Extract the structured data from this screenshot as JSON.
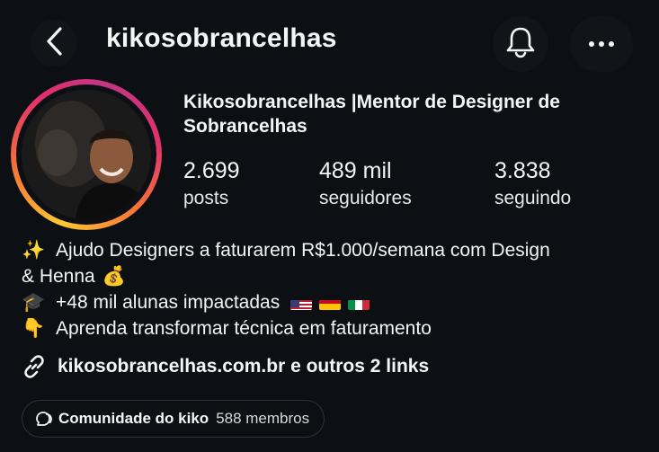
{
  "header": {
    "username": "kikosobrancelhas",
    "icons": [
      "chevron-left-icon",
      "bell-icon",
      "more-horizontal-icon"
    ]
  },
  "profile": {
    "display_name": "Kikosobrancelhas |Mentor de Designer de Sobrancelhas",
    "stats": [
      {
        "value": "2.699",
        "label": "posts"
      },
      {
        "value": "489 mil",
        "label": "seguidores"
      },
      {
        "value": "3.838",
        "label": "seguindo"
      }
    ]
  },
  "bio": {
    "line1_emoji": "✨",
    "line1_text": "Ajudo Designers a faturarem R$1.000/semana com Design",
    "line1b_text": "& Henna",
    "line1b_emoji": "💰",
    "line2_emoji": "🎓",
    "line2_text": "+48 mil alunas impactadas",
    "line3_emoji": "👇",
    "line3_text": "Aprenda transformar técnica em faturamento"
  },
  "links": {
    "text": "kikosobrancelhas.com.br e outros 2 links"
  },
  "community": {
    "name": "Comunidade do kiko",
    "members": "588 membros"
  },
  "colors": {
    "background": "#0c1014",
    "text": "#f5f5f5",
    "story_ring_start": "#fdc830",
    "story_ring_end": "#c13584"
  }
}
